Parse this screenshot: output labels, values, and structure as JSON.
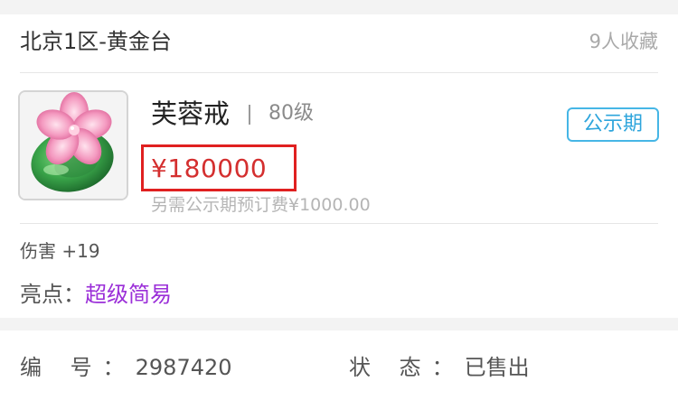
{
  "header": {
    "server": "北京1区-黄金台",
    "favorites": "9人收藏"
  },
  "item": {
    "icon": "jade-ring-with-pink-flower-icon",
    "name": "芙蓉戒",
    "level": "80级",
    "price": "¥180000",
    "fee_note": "另需公示期预订费¥1000.00",
    "status_tag": "公示期",
    "attribute": "伤害 +19",
    "highlight_label": "亮点：",
    "highlight_value": "超级简易"
  },
  "info": {
    "serial_label": "编 号：",
    "serial_value": "2987420",
    "state_label": "状 态：",
    "state_value": "已售出"
  },
  "colors": {
    "price": "#d42f2f",
    "tag_border": "#46b6e6",
    "highlight_value": "#9b2fd8",
    "annotation_box": "#e02020"
  }
}
